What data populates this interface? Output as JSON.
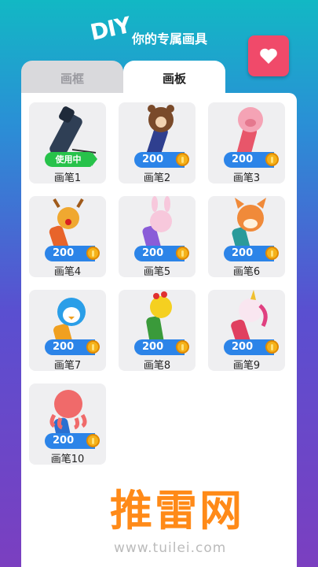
{
  "header": {
    "logo_text": "DIY",
    "subtitle": "你的专属画具"
  },
  "favorite": {
    "icon": "heart-icon"
  },
  "tabs": [
    {
      "label": "画框",
      "active": false
    },
    {
      "label": "画板",
      "active": true
    }
  ],
  "items": [
    {
      "label": "画笔1",
      "status": "使用中",
      "pen_color": "#2f3f55"
    },
    {
      "label": "画笔2",
      "price": "200",
      "pen_color": "#2f3f8f"
    },
    {
      "label": "画笔3",
      "price": "200",
      "pen_color": "#e8566a"
    },
    {
      "label": "画笔4",
      "price": "200",
      "pen_color": "#e8642a"
    },
    {
      "label": "画笔5",
      "price": "200",
      "pen_color": "#8a5cd8"
    },
    {
      "label": "画笔6",
      "price": "200",
      "pen_color": "#2a9a9a"
    },
    {
      "label": "画笔7",
      "price": "200",
      "pen_color": "#f0a020"
    },
    {
      "label": "画笔8",
      "price": "200",
      "pen_color": "#3a9a3a"
    },
    {
      "label": "画笔9",
      "price": "200",
      "pen_color": "#e04060"
    },
    {
      "label": "画笔10",
      "price": "200",
      "pen_color": "#2a70d0"
    }
  ],
  "currency_icon": "coin-icon",
  "watermark": {
    "brand": "推雷网",
    "url": "www.tuilei.com"
  }
}
